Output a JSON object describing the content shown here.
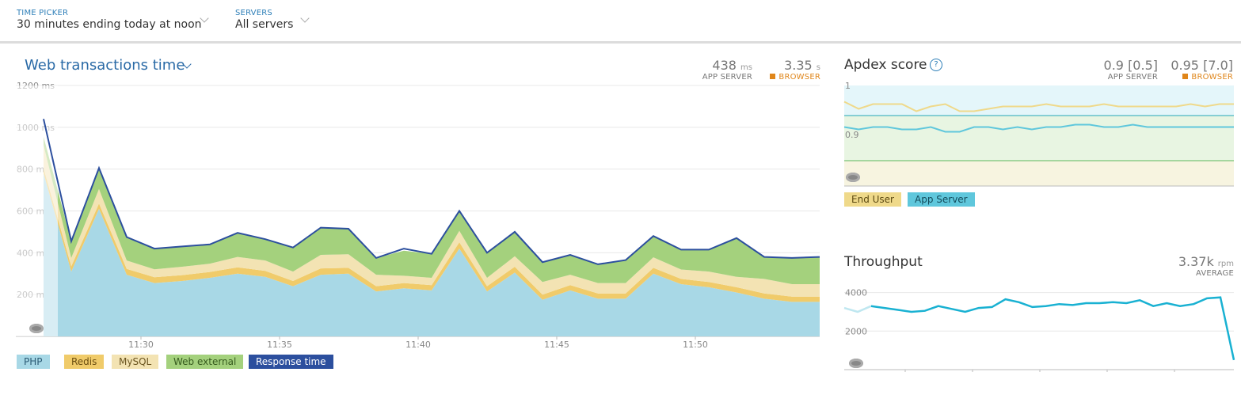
{
  "topbar": {
    "time_picker": {
      "label": "TIME PICKER",
      "value": "30 minutes ending today at noon"
    },
    "servers": {
      "label": "SERVERS",
      "value": "All servers"
    }
  },
  "web_panel": {
    "title": "Web transactions time",
    "app_server_value": "438",
    "app_server_unit": "ms",
    "app_server_caption": "APP SERVER",
    "browser_value": "3.35",
    "browser_unit": "s",
    "browser_caption": "BROWSER",
    "legend": [
      "PHP",
      "Redis",
      "MySQL",
      "Web external",
      "Response time"
    ]
  },
  "apdex_panel": {
    "title": "Apdex score",
    "help_icon": "question-icon",
    "app_server_value": "0.9 [0.5]",
    "app_server_caption": "APP SERVER",
    "browser_value": "0.95 [7.0]",
    "browser_caption": "BROWSER",
    "legend": [
      "End User",
      "App Server"
    ]
  },
  "throughput_panel": {
    "title": "Throughput",
    "value": "3.37k",
    "unit": "rpm",
    "caption": "AVERAGE"
  },
  "colors": {
    "php": "#a8d8e6",
    "redis": "#f0cb6a",
    "mysql": "#f3e3b3",
    "web_external": "#a4d17d",
    "response": "#2c4f9e",
    "accent": "#2a6aa6",
    "browser": "#e0861a",
    "enduser": "#efd98a",
    "appserver": "#5fc7dc",
    "throughput": "#19b1d2"
  },
  "chart_data": [
    {
      "type": "area",
      "title": "Web transactions time",
      "x": [
        "11:25",
        "11:26",
        "11:27",
        "11:28",
        "11:29",
        "11:30",
        "11:31",
        "11:32",
        "11:33",
        "11:34",
        "11:35",
        "11:36",
        "11:37",
        "11:38",
        "11:39",
        "11:40",
        "11:41",
        "11:42",
        "11:43",
        "11:44",
        "11:45",
        "11:46",
        "11:47",
        "11:48",
        "11:49",
        "11:50",
        "11:51",
        "11:52",
        "11:53",
        "11:54"
      ],
      "xticks": [
        "11:30",
        "11:35",
        "11:40",
        "11:45",
        "11:50"
      ],
      "yticks": [
        "200 ms",
        "400 ms",
        "600 ms",
        "800 ms",
        "1000 ms",
        "1200 ms"
      ],
      "ylim": [
        0,
        1200
      ],
      "series": [
        {
          "name": "PHP",
          "values": [
            780,
            310,
            610,
            295,
            255,
            265,
            280,
            300,
            285,
            240,
            295,
            300,
            215,
            230,
            220,
            420,
            215,
            305,
            175,
            220,
            180,
            180,
            300,
            250,
            235,
            210,
            180,
            165,
            165
          ]
        },
        {
          "name": "Redis",
          "values": [
            25,
            25,
            25,
            28,
            28,
            28,
            28,
            30,
            28,
            25,
            30,
            28,
            25,
            25,
            25,
            30,
            25,
            28,
            25,
            25,
            25,
            25,
            28,
            25,
            25,
            25,
            25,
            25,
            25
          ]
        },
        {
          "name": "MySQL",
          "values": [
            110,
            40,
            70,
            40,
            38,
            40,
            40,
            50,
            50,
            45,
            65,
            65,
            55,
            35,
            35,
            55,
            40,
            50,
            60,
            50,
            50,
            50,
            50,
            45,
            50,
            50,
            70,
            60,
            60
          ]
        },
        {
          "name": "Web external",
          "values": [
            40,
            80,
            100,
            110,
            100,
            100,
            95,
            115,
            105,
            115,
            130,
            120,
            80,
            120,
            115,
            95,
            120,
            120,
            95,
            95,
            90,
            110,
            105,
            95,
            105,
            185,
            105,
            125,
            130
          ]
        },
        {
          "name": "Response time",
          "values": [
            1040,
            455,
            805,
            475,
            420,
            430,
            440,
            495,
            465,
            425,
            520,
            515,
            375,
            420,
            395,
            600,
            400,
            500,
            355,
            390,
            345,
            365,
            480,
            415,
            415,
            470,
            380,
            375,
            380
          ]
        }
      ]
    },
    {
      "type": "line",
      "title": "Apdex score",
      "yticks": [
        "1",
        "0.9"
      ],
      "series": [
        {
          "name": "End User",
          "values": [
            0.97,
            0.94,
            0.96,
            0.96,
            0.96,
            0.93,
            0.95,
            0.96,
            0.93,
            0.93,
            0.94,
            0.95,
            0.95,
            0.95,
            0.96,
            0.95,
            0.95,
            0.95,
            0.96,
            0.95,
            0.95,
            0.95,
            0.95,
            0.95,
            0.96,
            0.95,
            0.96,
            0.96
          ]
        },
        {
          "name": "App Server",
          "values": [
            0.89,
            0.88,
            0.89,
            0.89,
            0.88,
            0.88,
            0.89,
            0.87,
            0.87,
            0.89,
            0.89,
            0.88,
            0.89,
            0.88,
            0.89,
            0.89,
            0.9,
            0.9,
            0.89,
            0.89,
            0.9,
            0.89,
            0.89,
            0.89,
            0.89,
            0.89,
            0.89,
            0.89
          ]
        }
      ]
    },
    {
      "type": "line",
      "title": "Throughput",
      "xticks": [
        "11:30",
        "11:35",
        "11:40",
        "11:45",
        "11:50"
      ],
      "yticks": [
        "4000",
        "2000"
      ],
      "series": [
        {
          "name": "Throughput",
          "values": [
            3200,
            3000,
            3300,
            3200,
            3100,
            3000,
            3050,
            3300,
            3150,
            3000,
            3200,
            3250,
            3650,
            3500,
            3250,
            3300,
            3400,
            3350,
            3450,
            3450,
            3500,
            3450,
            3600,
            3300,
            3450,
            3300,
            3400,
            3700,
            3750,
            500
          ]
        }
      ]
    }
  ]
}
